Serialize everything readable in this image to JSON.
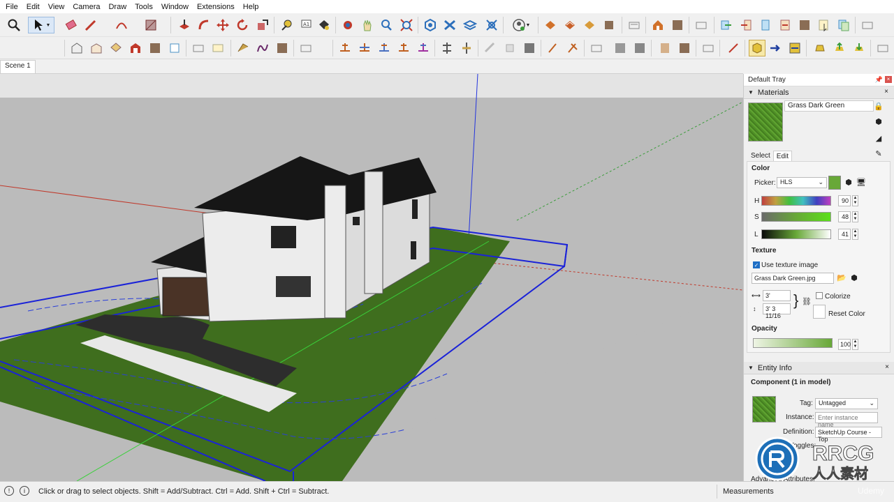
{
  "menu": {
    "items": [
      "File",
      "Edit",
      "View",
      "Camera",
      "Draw",
      "Tools",
      "Window",
      "Extensions",
      "Help"
    ]
  },
  "toolbar": {
    "icons_row1": [
      "magnify-icon",
      "select-icon",
      "eraser-icon",
      "pencil-icon",
      "arc-icon",
      "rectangle-icon",
      "push-pull-icon",
      "follow-me-icon",
      "move-icon",
      "rotate-icon",
      "scale-icon",
      "tape-measure-icon",
      "text-icon",
      "paint-bucket-icon",
      "orbit-icon",
      "pan-icon",
      "zoom-icon",
      "zoom-extents-icon",
      "styles-icon",
      "xray-icon",
      "layers-icon",
      "sections-icon",
      "user-icon",
      "warehouse-icon",
      "extension-icon",
      "component-icon",
      "solid-icon",
      "house-icon",
      "folder-icon",
      "export-icon"
    ],
    "icons_row2": [
      "front-view-icon",
      "side-view-icon",
      "top-view-icon",
      "back-view-icon",
      "iso-view-icon",
      "wireframe-icon",
      "shaded-icon",
      "texture-icon",
      "sandbox-icon",
      "smooth-icon",
      "grid-icon",
      "flip-icon",
      "stamp-icon",
      "drape-icon",
      "add-detail-icon",
      "flip-edge-icon",
      "solid-tool-icon",
      "trim-icon",
      "split-icon",
      "sun-icon",
      "shadow-icon",
      "fog-icon",
      "measure-icon",
      "layout-icon",
      "send-icon",
      "import-icon",
      "upload-icon"
    ]
  },
  "scene": {
    "tab_label": "Scene 1"
  },
  "tray": {
    "title": "Default Tray",
    "materials": {
      "header": "Materials",
      "name": "Grass Dark Green",
      "tabs": [
        "Select",
        "Edit"
      ],
      "color_label": "Color",
      "picker_label": "Picker:",
      "picker_value": "HLS",
      "h_label": "H",
      "h_value": "90",
      "s_label": "S",
      "s_value": "48",
      "l_label": "L",
      "l_value": "41",
      "texture_label": "Texture",
      "use_texture_label": "Use texture image",
      "texture_file": "Grass Dark Green.jpg",
      "width_value": "3'",
      "height_value": "3' 3 11/16",
      "colorize_label": "Colorize",
      "reset_color_label": "Reset Color",
      "opacity_label": "Opacity",
      "opacity_value": "100",
      "color_hex": "#68a838"
    },
    "entity_info": {
      "header": "Entity Info",
      "title": "Component (1 in model)",
      "tag_label": "Tag:",
      "tag_value": "Untagged",
      "instance_label": "Instance:",
      "instance_placeholder": "Enter instance name",
      "definition_label": "Definition:",
      "definition_value": "SketchUp Course - Top",
      "toggles_label": "Toggles:",
      "advanced_label": "Advanced Attributes:"
    }
  },
  "status": {
    "hint": "Click or drag to select objects. Shift = Add/Subtract. Ctrl = Add. Shift + Ctrl = Subtract.",
    "measurements_label": "Measurements"
  },
  "overlay": {
    "brand": "RRCG",
    "brand_cn": "人人素材",
    "udemy": "Udemy"
  }
}
